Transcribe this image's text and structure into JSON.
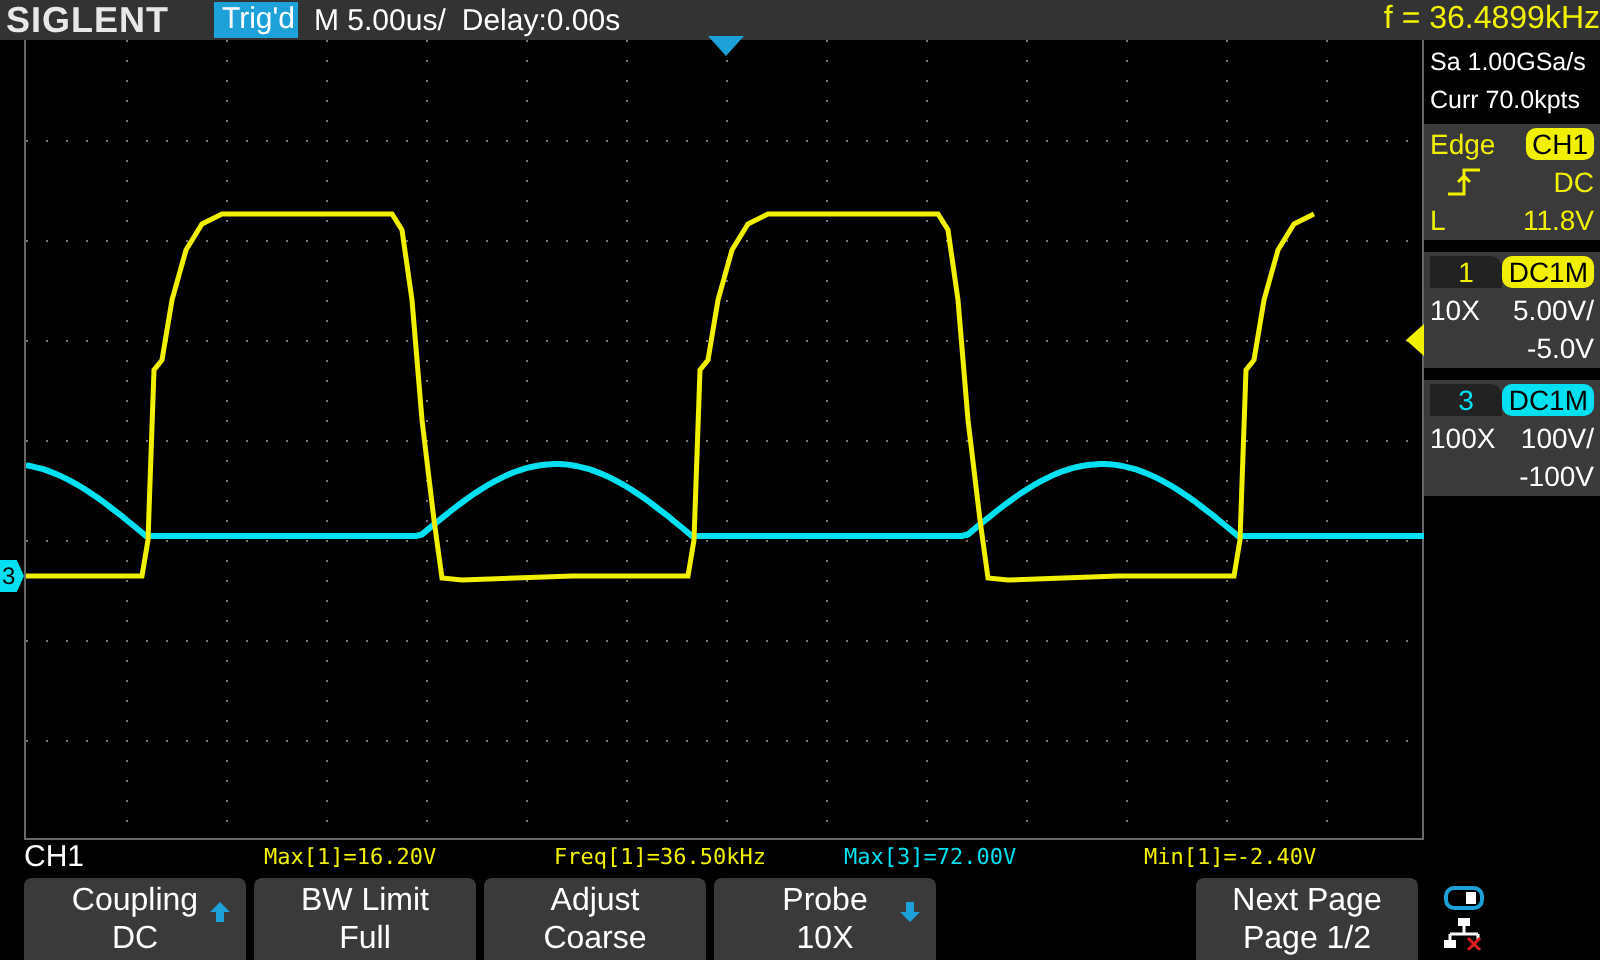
{
  "header": {
    "logo": "SIGLENT",
    "trigger_status": "Trig'd",
    "timebase": "M 5.00us/",
    "delay": "Delay:0.00s",
    "frequency": "f = 36.4899kHz"
  },
  "acquisition": {
    "sample_rate": "Sa 1.00GSa/s",
    "memory": "Curr 70.0kpts"
  },
  "trigger": {
    "type": "Edge",
    "source": "CH1",
    "coupling": "DC",
    "level_label": "L",
    "level_value": "11.8V"
  },
  "channels": [
    {
      "number": "1",
      "probe": "10X",
      "coupling": "DC1M",
      "scale": "5.00V/",
      "offset": "-5.0V",
      "color": "#f0f000"
    },
    {
      "number": "3",
      "probe": "100X",
      "coupling": "DC1M",
      "scale": "100V/",
      "offset": "-100V",
      "color": "#00e0f0"
    }
  ],
  "channel_marker": "3",
  "menu_title": "CH1",
  "measurements": [
    {
      "text": "Max[1]=16.20V",
      "color": "#f0f000"
    },
    {
      "text": "Freq[1]=36.50kHz",
      "color": "#f0f000"
    },
    {
      "text": "Max[3]=72.00V",
      "color": "#00e0f0"
    },
    {
      "text": "Min[1]=-2.40V",
      "color": "#f0f000"
    }
  ],
  "softkeys": [
    {
      "kind": "key",
      "title": "Coupling",
      "value": "DC",
      "arrow_up": true,
      "arrow_down": false
    },
    {
      "kind": "key",
      "title": "BW Limit",
      "value": "Full",
      "arrow_up": false,
      "arrow_down": false
    },
    {
      "kind": "key",
      "title": "Adjust",
      "value": "Coarse",
      "arrow_up": false,
      "arrow_down": false
    },
    {
      "kind": "key",
      "title": "Probe",
      "value": "10X",
      "arrow_up": false,
      "arrow_down": true
    },
    {
      "kind": "blank"
    },
    {
      "kind": "key",
      "title": "Next Page",
      "value": "Page 1/2",
      "arrow_up": false,
      "arrow_down": false
    }
  ]
}
